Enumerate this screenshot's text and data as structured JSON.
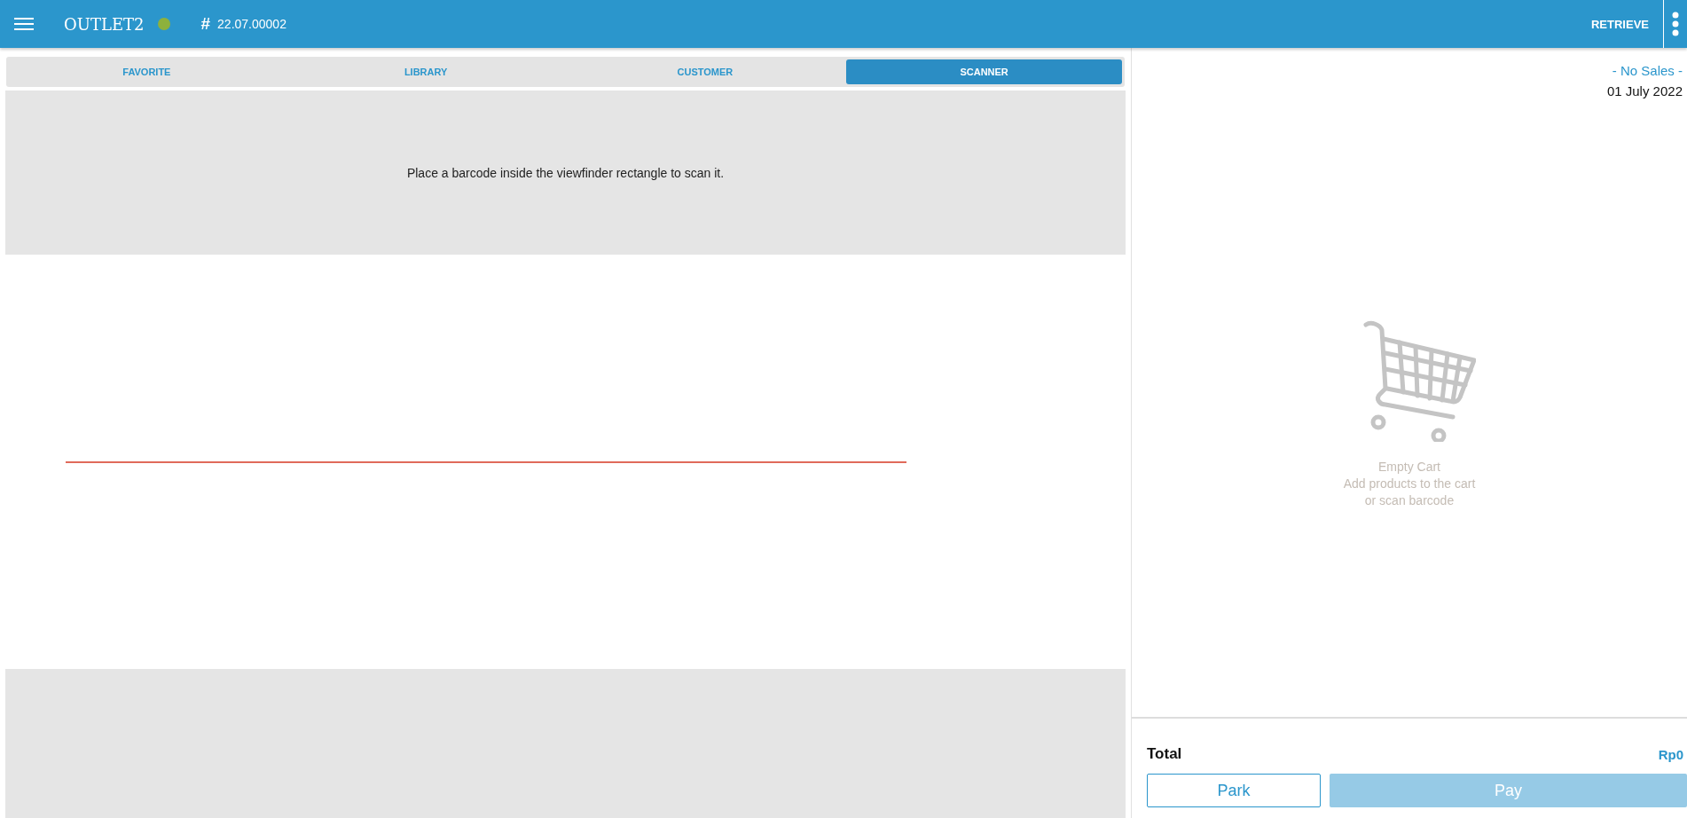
{
  "header": {
    "outlet": "OUTLET2",
    "online": true,
    "receipt_symbol": "#",
    "receipt_number": "22.07.00002",
    "retrieve": "RETRIEVE"
  },
  "tabs": [
    {
      "label": "FAVORITE",
      "selected": false
    },
    {
      "label": "LIBRARY",
      "selected": false
    },
    {
      "label": "CUSTOMER",
      "selected": false
    },
    {
      "label": "SCANNER",
      "selected": true
    }
  ],
  "scanner": {
    "message": "Place a barcode inside the viewfinder rectangle to scan it."
  },
  "cart": {
    "sales_label": "- No Sales -",
    "date": "01 July 2022",
    "empty_title": "Empty Cart",
    "empty_lines": [
      "Add products to the cart",
      "or scan barcode"
    ],
    "total_label": "Total",
    "total_value": "Rp0"
  },
  "buttons": [
    {
      "label": "Park",
      "kind": "outline",
      "disabled": false
    },
    {
      "label": "Pay",
      "kind": "primary",
      "disabled": true
    }
  ]
}
